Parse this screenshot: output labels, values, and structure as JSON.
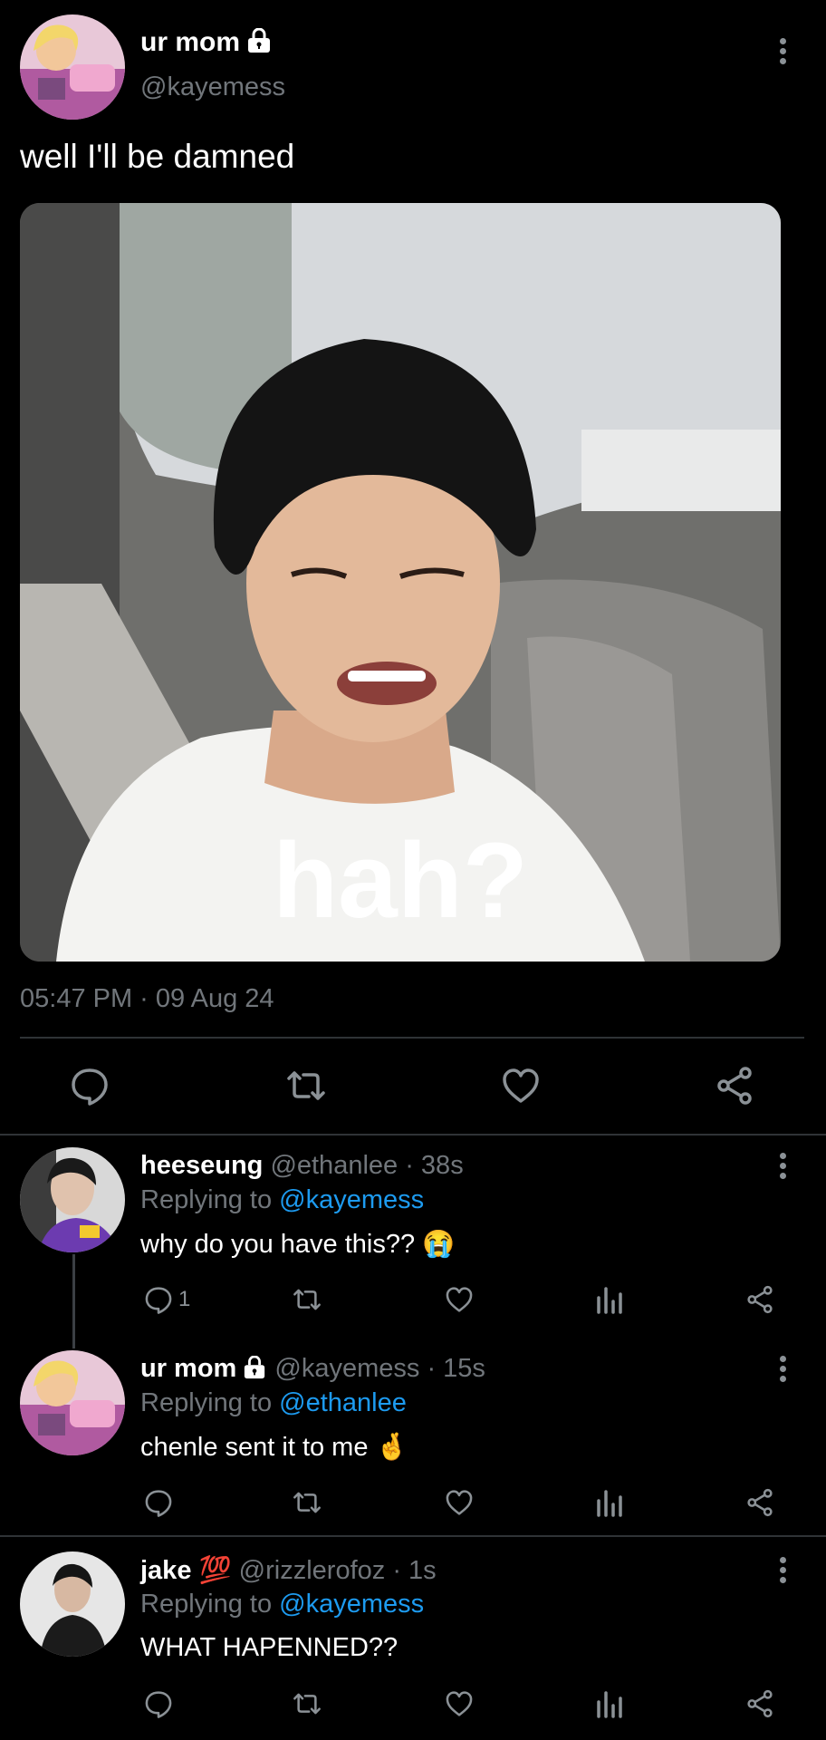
{
  "main_tweet": {
    "display_name": "ur mom",
    "handle": "@kayemess",
    "text": "well I'll be damned",
    "media_caption": "hah?",
    "timestamp": "05:47 PM · 09 Aug 24"
  },
  "replies": [
    {
      "display_name": "heeseung",
      "handle": "@ethanlee",
      "time": "· 38s",
      "replying_prefix": "Replying to",
      "replying_to": "@kayemess",
      "text": "why do you have this?? 😭",
      "reply_count": "1"
    },
    {
      "display_name": "ur mom",
      "handle": "@kayemess",
      "time": "· 15s",
      "replying_prefix": "Replying to",
      "replying_to": "@ethanlee",
      "text": "chenle sent it to me 🤞",
      "reply_count": ""
    },
    {
      "display_name": "jake 💯",
      "handle": "@rizzlerofoz",
      "time": "· 1s",
      "replying_prefix": "Replying to",
      "replying_to": "@kayemess",
      "text": "WHAT HAPENNED??",
      "reply_count": ""
    }
  ],
  "icons": {
    "reply": "speech-bubble-icon",
    "retweet": "retweet-icon",
    "like": "heart-icon",
    "views": "bar-chart-icon",
    "share": "share-icon",
    "more": "kebab-menu-icon",
    "protected": "lock-icon"
  },
  "colors": {
    "background": "#000000",
    "text": "#ffffff",
    "muted": "#71767b",
    "link": "#1d9bf0",
    "divider": "#2f3336"
  }
}
